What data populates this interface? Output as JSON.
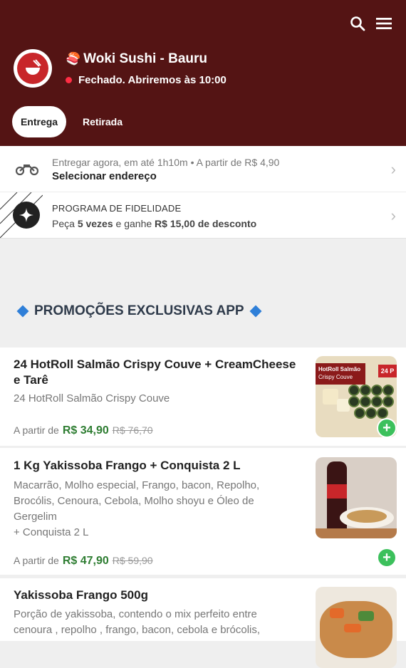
{
  "header": {
    "store_name": "Woki Sushi - Bauru",
    "store_emoji": "🍣",
    "status_text": "Fechado. Abriremos às 10:00",
    "status_color": "#ff2d44",
    "background_color": "#541414",
    "icons": [
      "search-icon",
      "menu-icon"
    ]
  },
  "tabs": {
    "delivery": "Entrega",
    "pickup": "Retirada",
    "active": "Entrega"
  },
  "delivery": {
    "line1": "Entregar agora, em até 1h10m",
    "separator": "•",
    "line1b": "A partir de R$ 4,90",
    "line2": "Selecionar endereço",
    "icon": "motorcycle-icon"
  },
  "loyalty": {
    "title": "PROGRAMA DE FIDELIDADE",
    "desc_pre": "Peça ",
    "desc_bold1": "5 vezes",
    "desc_mid": " e ganhe ",
    "desc_bold2": "R$ 15,00 de desconto",
    "icon": "sparkle-icon"
  },
  "section": {
    "title": "PROMOÇÕES EXCLUSIVAS APP"
  },
  "products": [
    {
      "name": "24 HotRoll Salmão Crispy Couve + CreamCheese e Tarê",
      "description": "24 HotRoll Salmão Crispy Couve",
      "price_prefix": "A partir de",
      "price": "R$ 34,90",
      "old_price": "R$ 76,70",
      "image_label_1": "HotRoll Salmão",
      "image_label_2": "Crispy Couve",
      "image_badge": "24 P"
    },
    {
      "name": "1 Kg Yakissoba Frango + Conquista 2 L",
      "description_line1": "Macarrão, Molho especial, Frango, bacon, Repolho, Brocólis, Cenoura, Cebola, Molho shoyu e Óleo de Gergelim",
      "description_line2": "+ Conquista 2 L",
      "price_prefix": "A partir de",
      "price": "R$ 47,90",
      "old_price": "R$ 59,90"
    },
    {
      "name": "Yakissoba Frango 500g",
      "description": "Porção de yakissoba, contendo o mix perfeito entre cenoura , repolho , frango, bacon, cebola e brócolis,"
    }
  ],
  "colors": {
    "accent_green": "#2e7d32",
    "add_button": "#3cc05c",
    "section_diamond": "#2f7fd8"
  }
}
